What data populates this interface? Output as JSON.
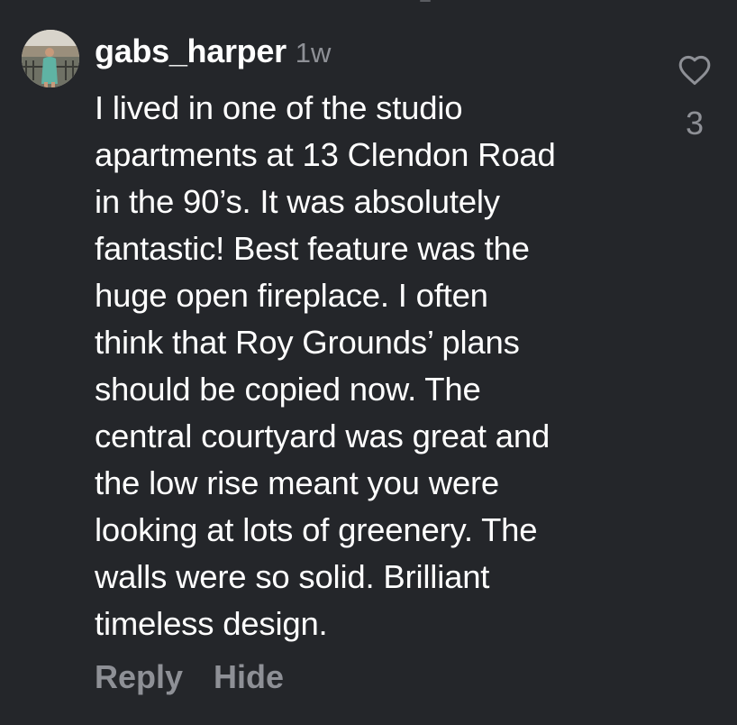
{
  "comment": {
    "username": "gabs_harper",
    "timestamp": "1w",
    "body_lines": [
      "I lived in one of the studio",
      "apartments at 13 Clendon Road",
      "in the 90’s. It was absolutely",
      "fantastic! Best feature was the",
      "huge open fireplace. I often",
      "think that Roy Grounds’ plans",
      "should be copied now. The",
      "central courtyard was great and",
      "the low rise meant you were",
      "looking at lots of greenery. The",
      "walls were so solid. Brilliant",
      "timeless design."
    ],
    "reply_label": "Reply",
    "hide_label": "Hide",
    "like_icon": "heart-outline-icon",
    "like_count": "3"
  },
  "colors": {
    "background": "#24262a",
    "text": "#ffffff",
    "muted": "#8e9096"
  }
}
